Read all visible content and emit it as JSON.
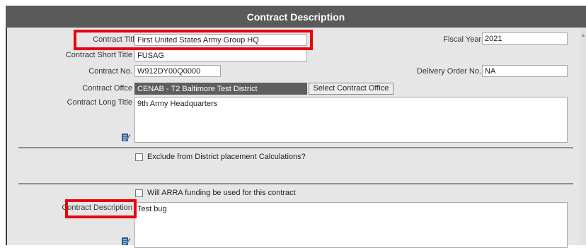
{
  "window": {
    "title": "Contract Description"
  },
  "fields": {
    "contract_title": {
      "label": "Contract Title",
      "value": "First United States Army Group  HQ"
    },
    "fiscal_year": {
      "label": "Fiscal Year",
      "value": "2021"
    },
    "contract_short_title": {
      "label": "Contract Short Title",
      "value": "FUSAG"
    },
    "contract_no": {
      "label": "Contract No.",
      "value": "W912DY00Q0000"
    },
    "delivery_order_no": {
      "label": "Delivery Order No.",
      "value": "NA"
    },
    "contract_office": {
      "label": "Contract Offce",
      "value": "CENAB - T2 Baltimore Test District",
      "button": "Select Contract Office"
    },
    "contract_long_title": {
      "label": "Contract Long Title",
      "value": "9th Army Headquarters"
    },
    "exclude_district": {
      "label": "Exclude from District placement Calculations?",
      "checked": false
    },
    "arra_funding": {
      "label": "Will ARRA funding be used for this contract",
      "checked": false
    },
    "contract_description": {
      "label": "Contract Description",
      "value": "Test bug"
    }
  },
  "icons": {
    "edit": "notepad-edit-icon"
  },
  "colors": {
    "titlebar": "#5a5a5a",
    "highlight": "#e8000b",
    "dark_field": "#5e5e5e"
  }
}
